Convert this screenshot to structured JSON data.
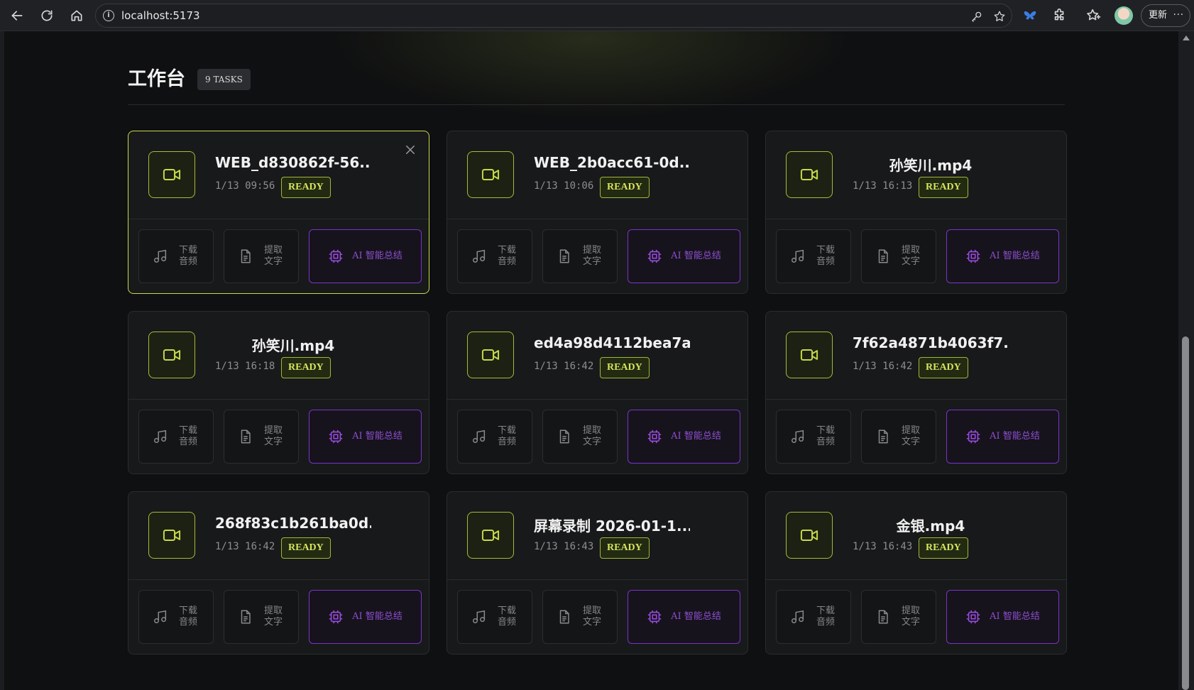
{
  "browser": {
    "url": "localhost:5173",
    "update_label": "更新",
    "more_label": "···"
  },
  "header": {
    "title": "工作台",
    "task_count": "9 TASKS"
  },
  "actions": {
    "audio_label": "下载音频",
    "text_label": "提取文字",
    "ai_label": "AI 智能总结"
  },
  "tasks": [
    {
      "name": "WEB_d830862f-56...",
      "time": "1/13 09:56",
      "status": "READY"
    },
    {
      "name": "WEB_2b0acc61-0d...",
      "time": "1/13 10:06",
      "status": "READY"
    },
    {
      "name": "孙笑川.mp4",
      "time": "1/13 16:13",
      "status": "READY"
    },
    {
      "name": "孙笑川.mp4",
      "time": "1/13 16:18",
      "status": "READY"
    },
    {
      "name": "ed4a98d4112bea7a...",
      "time": "1/13 16:42",
      "status": "READY"
    },
    {
      "name": "7f62a4871b4063f7...",
      "time": "1/13 16:42",
      "status": "READY"
    },
    {
      "name": "268f83c1b261ba0d...",
      "time": "1/13 16:42",
      "status": "READY"
    },
    {
      "name": "屏幕录制 2026-01-1...",
      "time": "1/13 16:43",
      "status": "READY"
    },
    {
      "name": "金银.mp4",
      "time": "1/13 16:43",
      "status": "READY"
    }
  ],
  "colors": {
    "accent_green": "#c8d94a",
    "accent_purple": "#7a33cc",
    "background": "#0f1011"
  },
  "icons": {
    "file": "video-camera-icon",
    "audio": "music-note-icon",
    "text": "document-icon",
    "ai": "cpu-chip-icon",
    "close": "close-icon"
  }
}
